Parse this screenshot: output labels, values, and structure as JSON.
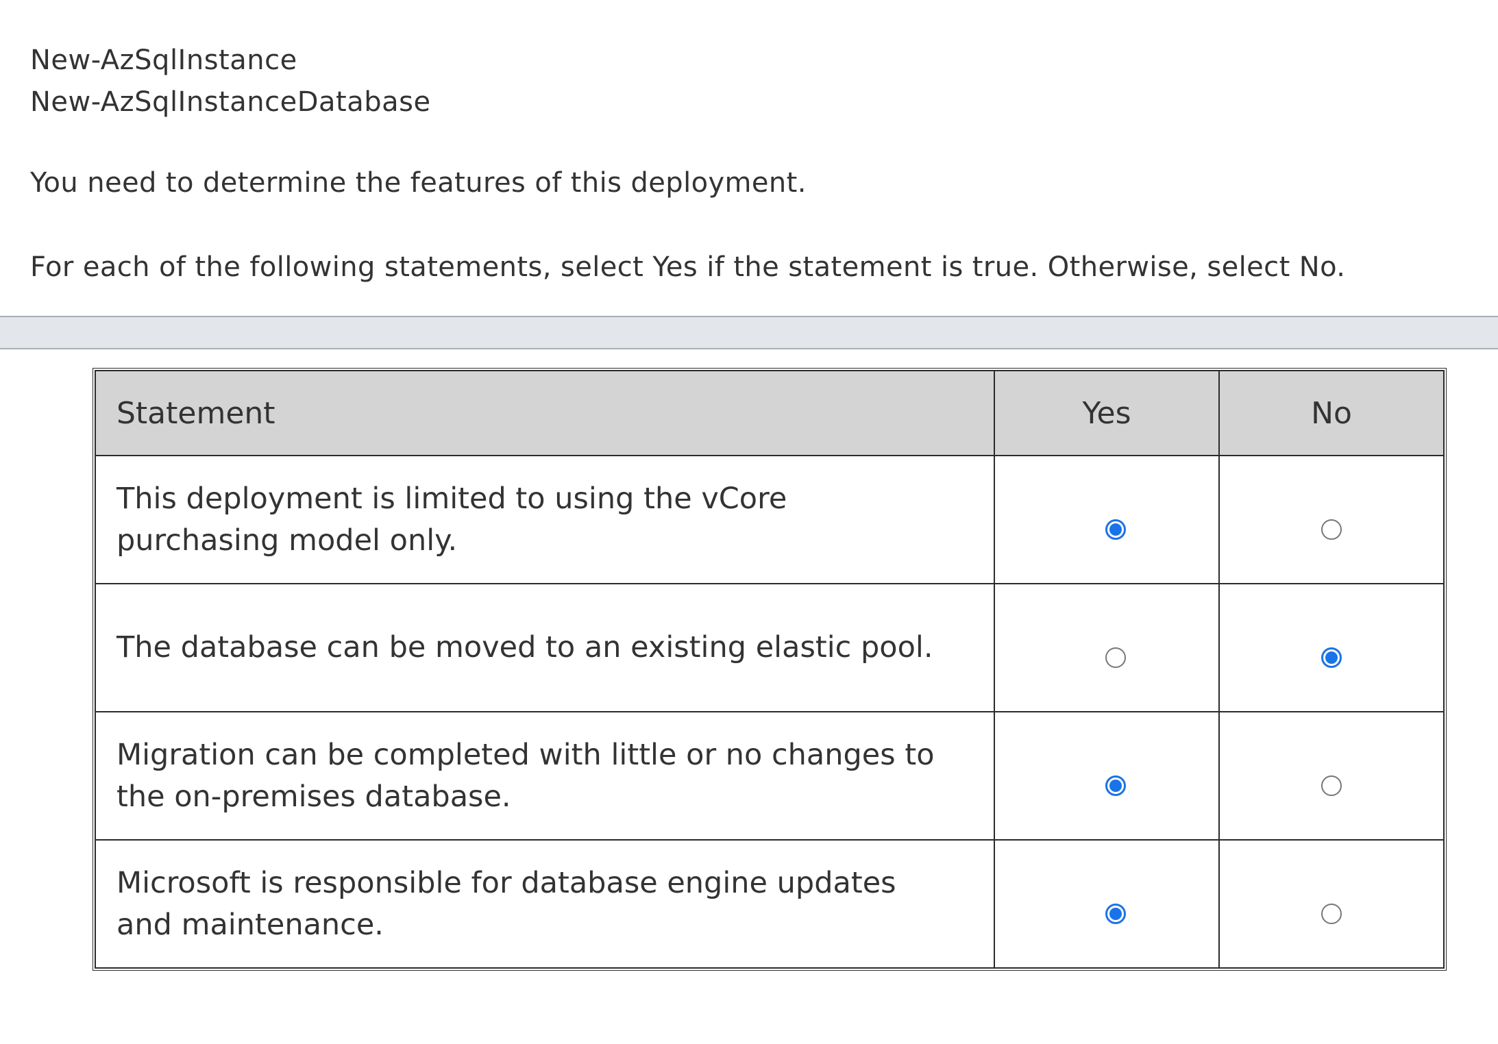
{
  "commands": [
    "New-AzSqlInstance",
    "New-AzSqlInstanceDatabase"
  ],
  "intro": "You need to determine the features of this deployment.",
  "instruction": "For each of the following statements, select Yes if the statement is true. Otherwise, select No.",
  "table": {
    "headers": {
      "statement": "Statement",
      "yes": "Yes",
      "no": "No"
    },
    "rows": [
      {
        "statement": "This deployment is limited to using the vCore purchasing model only.",
        "selected": "Yes"
      },
      {
        "statement": "The database can be moved to an existing elastic pool.",
        "selected": "No"
      },
      {
        "statement": "Migration can be completed with little or no changes to the on-premises database.",
        "selected": "Yes"
      },
      {
        "statement": "Microsoft is responsible for database engine updates and maintenance.",
        "selected": "Yes"
      }
    ]
  },
  "colors": {
    "radio_selected": "#1a73e8",
    "header_background": "#d4d4d4",
    "divider_background": "#e3e7eb"
  }
}
